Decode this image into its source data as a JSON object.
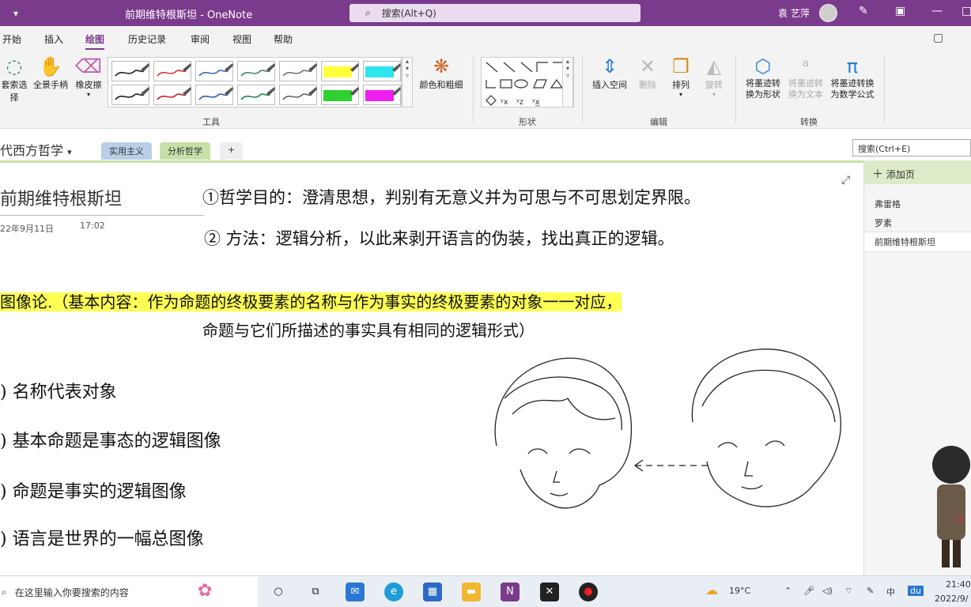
{
  "titlebar": {
    "qat_icon": "qat-chevron-icon",
    "title": "前期维特根斯坦  -  OneNote",
    "search_placeholder": "搜索(Alt+Q)",
    "user_name": "袁 艺萍"
  },
  "menu": {
    "tabs": [
      "开始",
      "插入",
      "绘图",
      "历史记录",
      "审阅",
      "视图",
      "帮助"
    ],
    "active": "绘图"
  },
  "ribbon": {
    "tools": {
      "lasso": "套索选择",
      "pan": "全景手柄",
      "eraser": "橡皮擦",
      "color_thickness": "颜色和粗细",
      "label": "工具"
    },
    "pens_row1": [
      "#222222",
      "#d93a3a",
      "#3a6fb5",
      "#3a8f5a",
      "#777777",
      "#ffff3a",
      "#2ee6ef"
    ],
    "pens_row2": [
      "#222222",
      "#cc2233",
      "#2a5fa5",
      "#1e8a4a",
      "#666666",
      "#2ed12e",
      "#f01ef0"
    ],
    "shapes_label": "形状",
    "edit": {
      "insert_space": "插入空间",
      "delete": "删除",
      "arrange": "排列",
      "rotate": "旋转",
      "label": "编辑"
    },
    "convert": {
      "ink_to_shape": "将墨迹转换为形状",
      "ink_to_text": "将墨迹转换为文本",
      "ink_to_math": "将墨迹转换为数学公式",
      "label": "转换"
    }
  },
  "notebook": {
    "name": "代西方哲学",
    "sections": [
      "实用主义",
      "分析哲学"
    ],
    "add_section": "+",
    "search_placeholder": "搜索(Ctrl+E)"
  },
  "page": {
    "title": "前期维特根斯坦",
    "date": "22年9月11日",
    "time": "17:02",
    "ink_lines": [
      "①哲学目的：澄清思想，判别有无意义并为可思与不可思划定界限。",
      "② 方法：逻辑分析，以此来剥开语言的伪装，找出真正的逻辑。",
      "图像论.（基本内容：作为命题的终极要素的名称与作为事实的终极要素的对象一一对应，",
      "命题与它们所描述的事实具有相同的逻辑形式）",
      ") 名称代表对象",
      ") 基本命题是事态的逻辑图像",
      ") 命题是事实的逻辑图像",
      ") 语言是世界的一幅总图像"
    ]
  },
  "pages_pane": {
    "add_page": "添加页",
    "items": [
      "弗雷格",
      "罗素",
      "前期维特根斯坦"
    ],
    "active": "前期维特根斯坦"
  },
  "taskbar": {
    "search_placeholder": "在这里输入你要搜索的内容",
    "weather": "19°C",
    "ime": "中",
    "baidu": "du",
    "time": "21:40",
    "date": "2022/9/"
  },
  "colors": {
    "accent": "#7b3b8c",
    "section_active": "#c8e0a8",
    "section_other": "#b9cfe8"
  }
}
